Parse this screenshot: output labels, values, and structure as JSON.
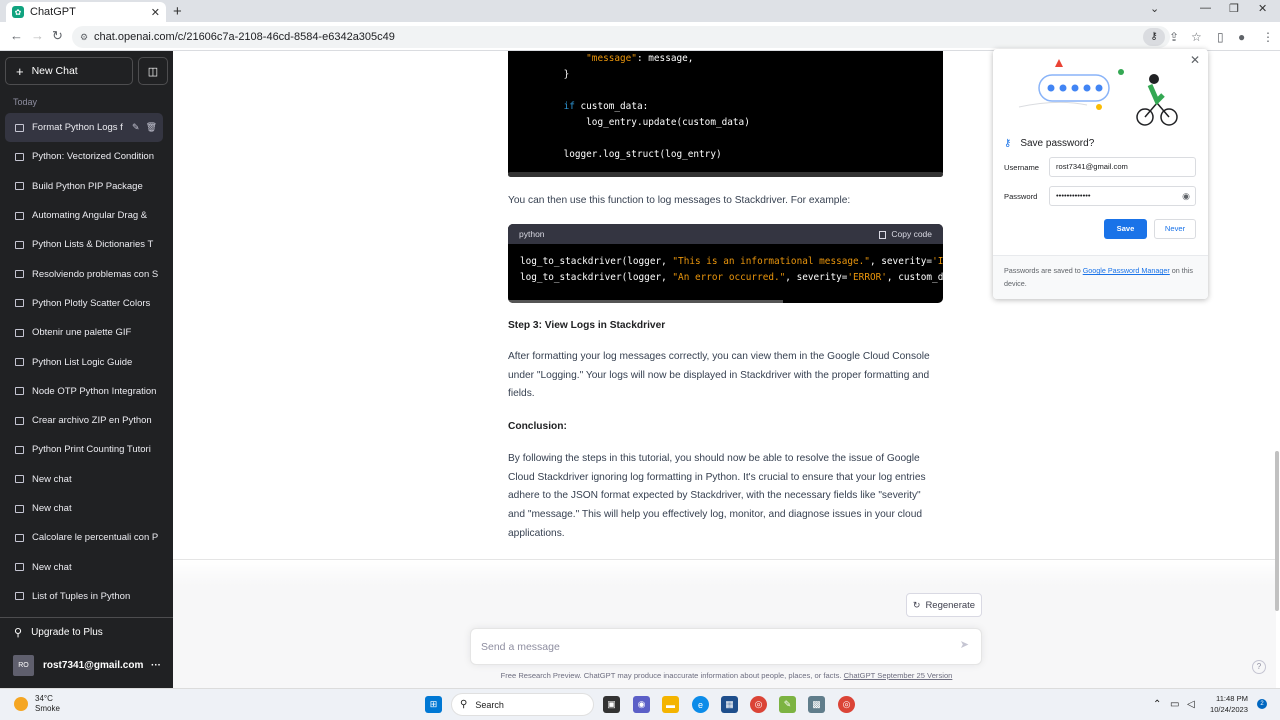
{
  "browser": {
    "tab_title": "ChatGPT",
    "tab_close": "✕",
    "new_tab": "+",
    "url": "chat.openai.com/c/21606c7a-2108-46cd-8584-e6342a305c49",
    "window_controls": [
      "⌄",
      "—",
      "❐",
      "✕"
    ]
  },
  "sidebar": {
    "new_chat": "New Chat",
    "section_label": "Today",
    "items": [
      {
        "label": "Format Python Logs f",
        "active": true
      },
      {
        "label": "Python: Vectorized Condition"
      },
      {
        "label": "Build Python PIP Package"
      },
      {
        "label": "Automating Angular Drag &"
      },
      {
        "label": "Python Lists & Dictionaries T"
      },
      {
        "label": "Resolviendo problemas con S"
      },
      {
        "label": "Python Plotly Scatter Colors"
      },
      {
        "label": "Obtenir une palette GIF"
      },
      {
        "label": "Python List Logic Guide"
      },
      {
        "label": "Node OTP Python Integration"
      },
      {
        "label": "Crear archivo ZIP en Python"
      },
      {
        "label": "Python Print Counting Tutori"
      },
      {
        "label": "New chat"
      },
      {
        "label": "New chat"
      },
      {
        "label": "Calcolare le percentuali con P"
      },
      {
        "label": "New chat"
      },
      {
        "label": "List of Tuples in Python"
      }
    ],
    "upgrade": "Upgrade to Plus",
    "account_initials": "RO",
    "account_email": "rost7341@gmail.com",
    "more": "···"
  },
  "content": {
    "code1_lines": [
      {
        "parts": [
          {
            "t": "        "
          },
          {
            "t": "\"message\"",
            "c": "str"
          },
          {
            "t": ": message,"
          }
        ]
      },
      {
        "parts": [
          {
            "t": "    }"
          }
        ]
      },
      {
        "parts": [
          {
            "t": ""
          }
        ]
      },
      {
        "parts": [
          {
            "t": "    "
          },
          {
            "t": "if",
            "c": "kw"
          },
          {
            "t": " custom_data:"
          }
        ]
      },
      {
        "parts": [
          {
            "t": "        log_entry.update(custom_data)"
          }
        ]
      },
      {
        "parts": [
          {
            "t": ""
          }
        ]
      },
      {
        "parts": [
          {
            "t": "    logger.log_struct(log_entry)"
          }
        ]
      }
    ],
    "para1": "You can then use this function to log messages to Stackdriver. For example:",
    "code2_lang": "python",
    "code2_copy": "Copy code",
    "code2_lines": [
      {
        "parts": [
          {
            "t": "log_to_stackdriver(logger, "
          },
          {
            "t": "\"This is an informational message.\"",
            "c": "str"
          },
          {
            "t": ", severity="
          },
          {
            "t": "'IN",
            "c": "str"
          }
        ]
      },
      {
        "parts": [
          {
            "t": "log_to_stackdriver(logger, "
          },
          {
            "t": "\"An error occurred.\"",
            "c": "str"
          },
          {
            "t": ", severity="
          },
          {
            "t": "'ERROR'",
            "c": "str"
          },
          {
            "t": ", custom_da"
          }
        ]
      }
    ],
    "step3_heading": "Step 3: View Logs in Stackdriver",
    "para2": "After formatting your log messages correctly, you can view them in the Google Cloud Console under \"Logging.\" Your logs will now be displayed in Stackdriver with the proper formatting and fields.",
    "conclusion_heading": "Conclusion:",
    "para3": "By following the steps in this tutorial, you should now be able to resolve the issue of Google Cloud Stackdriver ignoring log formatting in Python. It's crucial to ensure that your log entries adhere to the JSON format expected by Stackdriver, with the necessary fields like \"severity\" and \"message.\" This will help you effectively log, monitor, and diagnose issues in your cloud applications."
  },
  "composer": {
    "regenerate": "Regenerate",
    "placeholder": "Send a message",
    "footer_text": "Free Research Preview. ChatGPT may produce inaccurate information about people, places, or facts. ",
    "footer_link": "ChatGPT September 25 Version",
    "help": "?"
  },
  "password_popup": {
    "title": "Save password?",
    "username_label": "Username",
    "username_value": "rost7341@gmail.com",
    "password_label": "Password",
    "password_value": "•••••••••••••",
    "save": "Save",
    "never": "Never",
    "footer_prefix": "Passwords are saved to ",
    "footer_link": "Google Password Manager",
    "footer_suffix": " on this device."
  },
  "taskbar": {
    "temperature": "34°C",
    "weather": "Smoke",
    "search": "Search",
    "time": "11:48 PM",
    "date": "10/24/2023",
    "notifications": "2"
  },
  "colors": {
    "sidebar_bg": "#202123",
    "accent": "#10a37f",
    "save_button": "#1a73e8"
  }
}
